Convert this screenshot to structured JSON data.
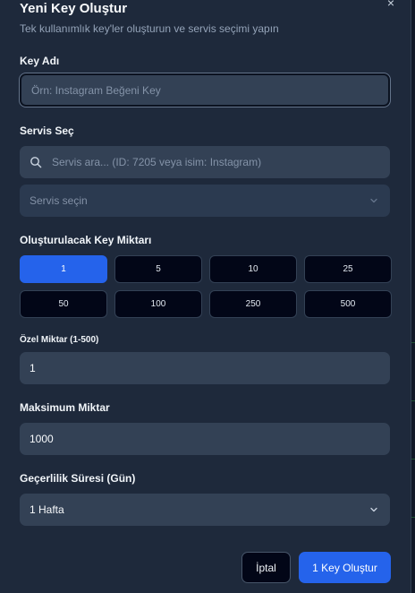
{
  "dialog": {
    "title": "Yeni Key Oluştur",
    "subtitle": "Tek kullanımlık key'ler oluşturun ve servis seçimi yapın",
    "close_glyph": "×"
  },
  "key_name": {
    "label": "Key Adı",
    "placeholder": "Örn: Instagram Beğeni Key",
    "value": ""
  },
  "service": {
    "label": "Servis Seç",
    "search_placeholder": "Servis ara... (ID: 7205 veya isim: Instagram)",
    "select_placeholder": "Servis seçin"
  },
  "quantity": {
    "label": "Oluşturulacak Key Miktarı",
    "options": [
      "1",
      "5",
      "10",
      "25",
      "50",
      "100",
      "250",
      "500"
    ],
    "selected": "1"
  },
  "custom_quantity": {
    "label": "Özel Miktar (1-500)",
    "value": "1"
  },
  "max_amount": {
    "label": "Maksimum Miktar",
    "value": "1000"
  },
  "validity": {
    "label": "Geçerlilik Süresi (Gün)",
    "value": "1 Hafta"
  },
  "actions": {
    "cancel_label": "İptal",
    "submit_label": "1 Key Oluştur"
  },
  "icons": {
    "search": "search-icon",
    "chevron": "chevron-down-icon",
    "close": "close-icon"
  },
  "colors": {
    "panel_bg": "#1e293b",
    "input_bg": "#334155",
    "accent": "#2563eb",
    "button_dark": "#020617"
  }
}
